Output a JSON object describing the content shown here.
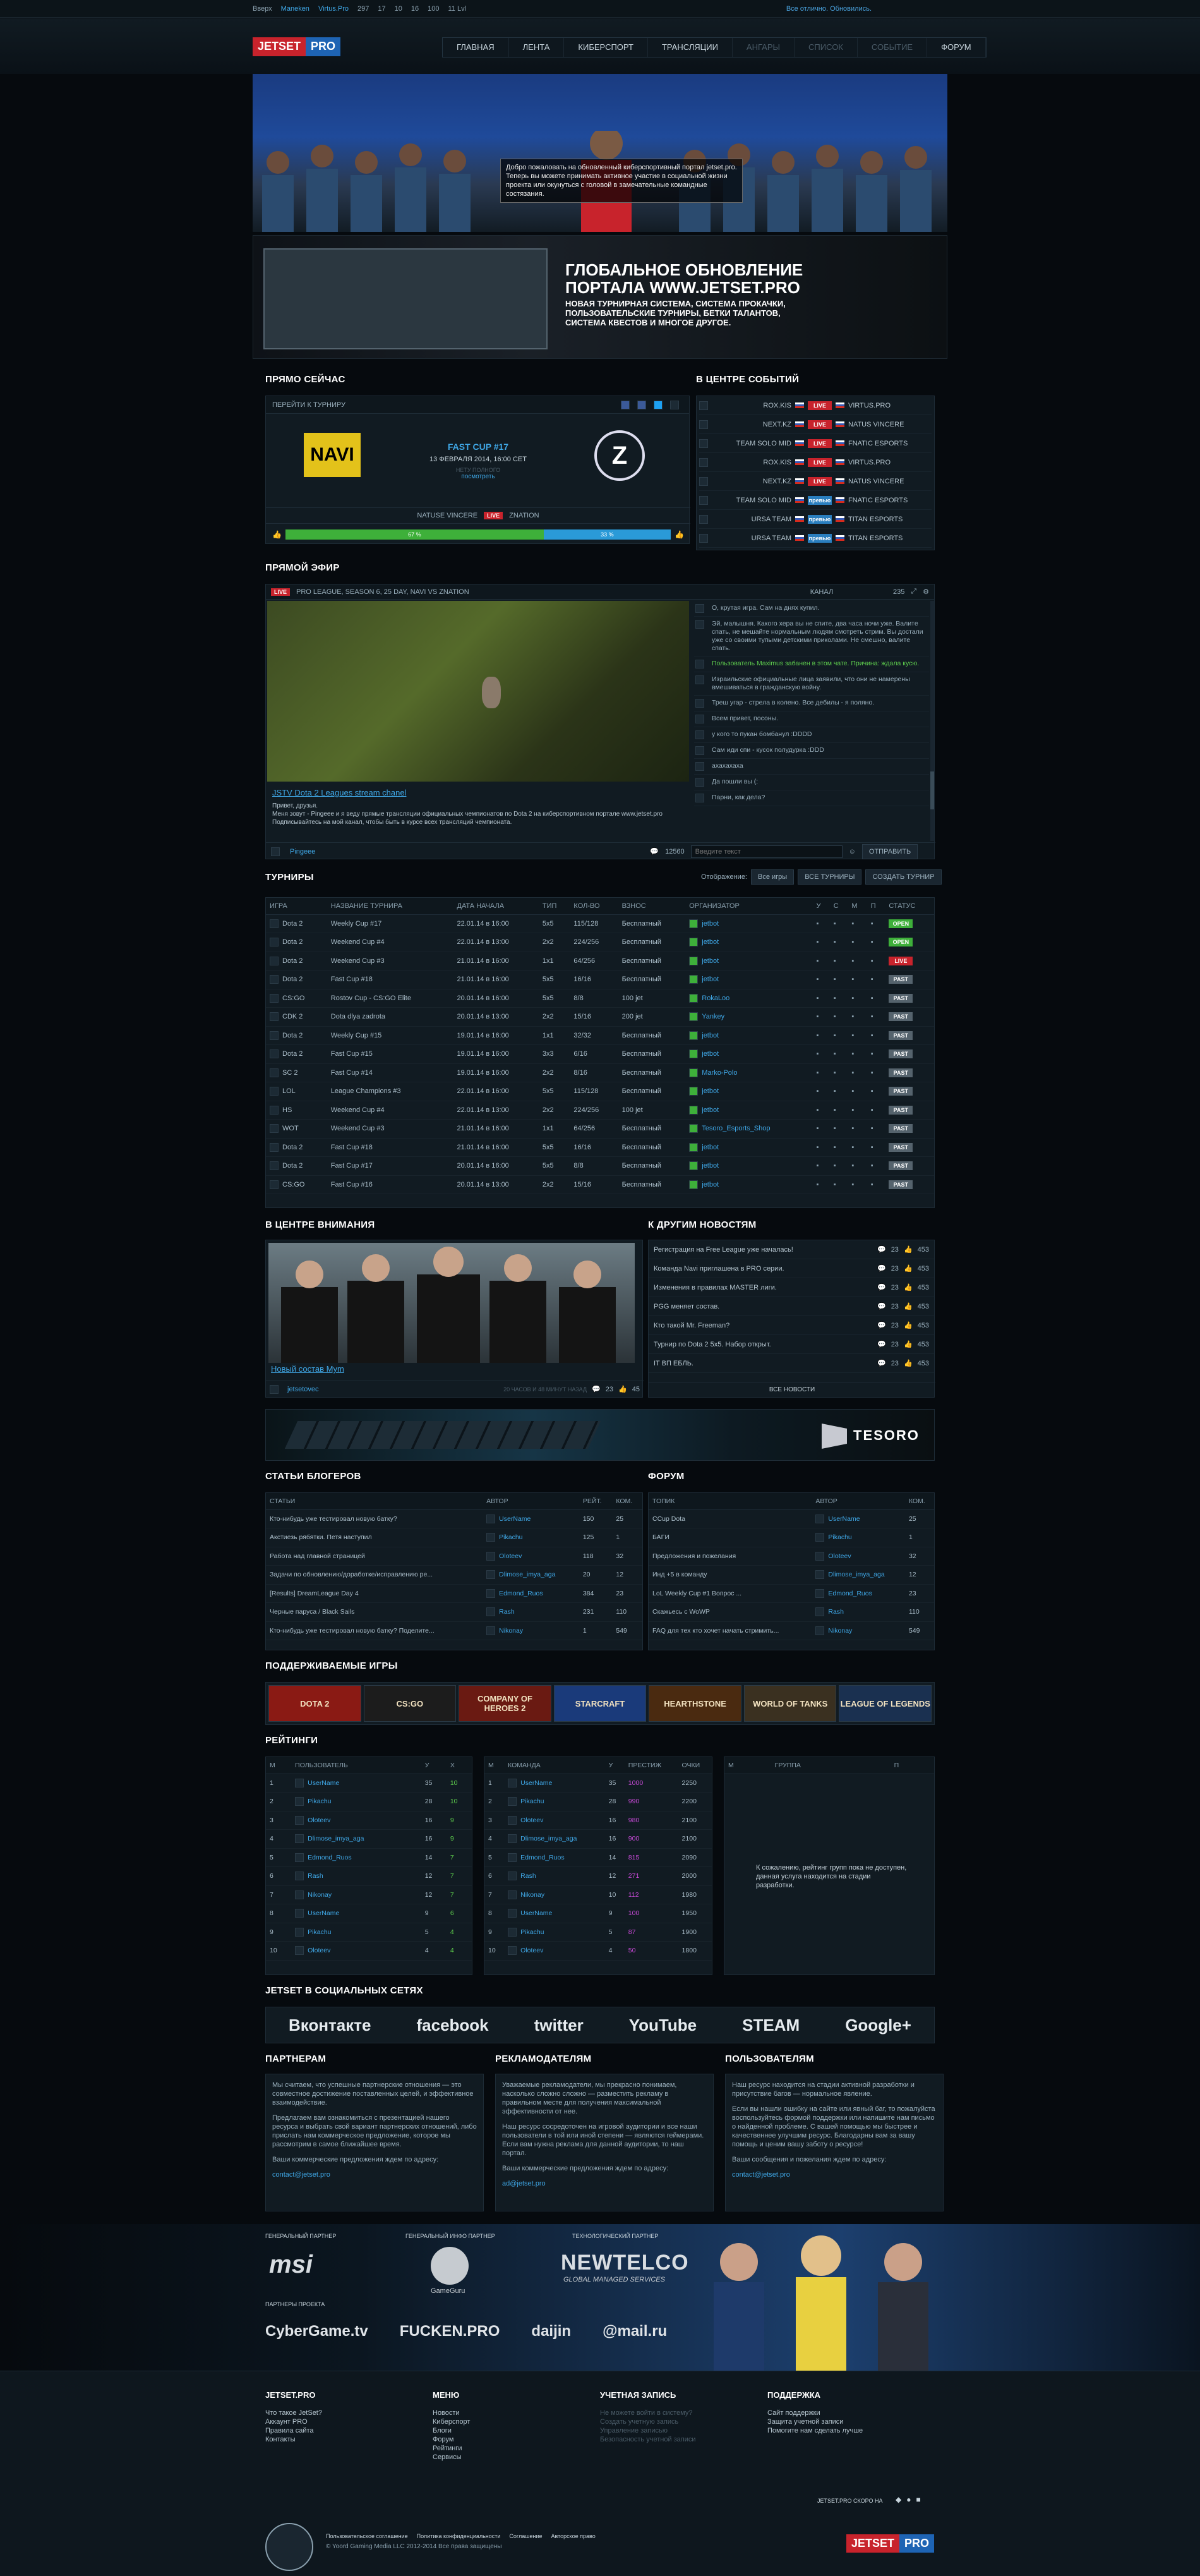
{
  "topbar": {
    "up": "Вверх",
    "items": [
      "Maneken",
      "Virtus.Pro",
      "297",
      "17",
      "10",
      "16",
      "100",
      "11 Lvl"
    ],
    "notice": "Все отлично. Обновились."
  },
  "nav": [
    "ГЛАВНАЯ",
    "ЛЕНТА",
    "КИБЕРСПОРТ",
    "ТРАНСЛЯЦИИ",
    "АНГАРЫ",
    "СПИСОК",
    "СОБЫТИЕ",
    "ФОРУМ"
  ],
  "banner": {
    "speech": "Добро пожаловать на обновленный киберспортивный портал jetset.pro. Теперь вы можете принимать активное участие в социальной жизни проекта или окунуться с головой в замечательные командные состязания."
  },
  "promo": {
    "title": "ГЛОБАЛЬНОЕ ОБНОВЛЕНИЕ ПОРТАЛА WWW.JETSET.PRO",
    "text": "НОВАЯ ТУРНИРНАЯ СИСТЕМА, СИСТЕМА ПРОКАЧКИ, ПОЛЬЗОВАТЕЛЬСКИЕ ТУРНИРЫ, БЕТКИ ТАЛАНТОВ, СИСТЕМА КВЕСТОВ И МНОГОЕ ДРУГОЕ."
  },
  "now": {
    "title": "ПРЯМО СЕЙЧАС",
    "goto": "ПЕРЕЙТИ К ТУРНИРУ",
    "cup": "FAST CUP #17",
    "date": "13 ФЕВРАЛЯ 2014, 16:00 CET",
    "watch": "НЕТУ ПОЛНОГО",
    "watch2": "посмотреть",
    "team1": "NATUSE VINCERE",
    "team2": "ZNATION",
    "left": "67 %",
    "right": "33 %"
  },
  "events": {
    "title": "В ЦЕНТРЕ СОБЫТИЙ",
    "rows": [
      {
        "a": "ROX.KIS",
        "s": "LIVE",
        "b": "VIRTUS.PRO"
      },
      {
        "a": "NEXT.KZ",
        "s": "LIVE",
        "b": "NATUS VINCERE"
      },
      {
        "a": "TEAM SOLO MID",
        "s": "LIVE",
        "b": "FNATIC ESPORTS"
      },
      {
        "a": "ROX.KIS",
        "s": "LIVE",
        "b": "VIRTUS.PRO"
      },
      {
        "a": "NEXT.KZ",
        "s": "LIVE",
        "b": "NATUS VINCERE"
      },
      {
        "a": "TEAM SOLO MID",
        "s": "превью",
        "b": "FNATIC ESPORTS"
      },
      {
        "a": "URSA TEAM",
        "s": "превью",
        "b": "TITAN ESPORTS"
      },
      {
        "a": "URSA TEAM",
        "s": "превью",
        "b": "TITAN ESPORTS"
      }
    ]
  },
  "stream": {
    "title": "ПРЯМОЙ ЭФИР",
    "live": "LIVE",
    "desc": "PRO LEAGUE, SEASON 6, 25 DAY, NAVI VS ZNATION",
    "channel": "КАНАЛ",
    "viewers": "235",
    "name": "JSTV Dota 2 Leagues stream chanel",
    "text": "Привет, друзья.\nМеня зовут - Pingeee и я веду прямые трансляции официальных чемпионатов по Dota 2 на киберспортивном портале www.jetset.pro Подписывайтесь на мой канал, чтобы быть в курсе всех трансляций чемпионата.",
    "author": "Pingeee",
    "count": "12560",
    "placeholder": "Введите текст",
    "send": "ОТПРАВИТЬ",
    "chat": [
      "О, крутая игра. Сам на днях купил.",
      "Эй, малышня. Какого хера вы не спите, два часа ночи уже. Валите спать, не мешайте нормальным людям смотреть стрим. Вы достали уже со своими тупыми детскими приколами. Не смешно, валите спать.",
      "Пользователь Maximus забанен в этом чате. Причина: ждала кусю.",
      "Израильские официальные лица заявили, что они не намерены вмешиваться в гражданскую войну.",
      "Треш угар - стрела в колено. Все дебилы - я поляно.",
      "Всем привет, посоны.",
      "у кого то пукан бомбанул :DDDD",
      "Сам иди спи - кусок полудурка :DDD",
      "ахахахаха",
      "Да пошли вы (:",
      "Парни, как дела?"
    ]
  },
  "tourn": {
    "title": "ТУРНИРЫ",
    "show": "Отображение:",
    "all": "Все игры",
    "alltour": "ВСЕ ТУРНИРЫ",
    "create": "СОЗДАТЬ ТУРНИР",
    "cols": [
      "ИГРА",
      "НАЗВАНИЕ ТУРНИРА",
      "ДАТА НАЧАЛА",
      "ТИП",
      "КОЛ-ВО",
      "ВЗНОС",
      "ОРГАНИЗАТОР",
      "У",
      "С",
      "М",
      "П",
      "СТАТУС"
    ],
    "rows": [
      [
        "Dota 2",
        "Weekly Cup #17",
        "22.01.14 в 16:00",
        "5x5",
        "115/128",
        "Бесплатный",
        "jetbot",
        "OPEN"
      ],
      [
        "Dota 2",
        "Weekend Cup #4",
        "22.01.14 в 13:00",
        "2x2",
        "224/256",
        "Бесплатный",
        "jetbot",
        "OPEN"
      ],
      [
        "Dota 2",
        "Weekend Cup #3",
        "21.01.14 в 16:00",
        "1x1",
        "64/256",
        "Бесплатный",
        "jetbot",
        "LIVE"
      ],
      [
        "Dota 2",
        "Fast Cup #18",
        "21.01.14 в 16:00",
        "5x5",
        "16/16",
        "Бесплатный",
        "jetbot",
        "PAST"
      ],
      [
        "CS:GO",
        "Rostov Cup - CS:GO Elite",
        "20.01.14 в 16:00",
        "5x5",
        "8/8",
        "100 jet",
        "RokaLoo",
        "PAST"
      ],
      [
        "CDK 2",
        "Dota dlya zadrota",
        "20.01.14 в 13:00",
        "2x2",
        "15/16",
        "200 jet",
        "Yankey",
        "PAST"
      ],
      [
        "Dota 2",
        "Weekly Cup #15",
        "19.01.14 в 16:00",
        "1x1",
        "32/32",
        "Бесплатный",
        "jetbot",
        "PAST"
      ],
      [
        "Dota 2",
        "Fast Cup #15",
        "19.01.14 в 16:00",
        "3x3",
        "6/16",
        "Бесплатный",
        "jetbot",
        "PAST"
      ],
      [
        "SC 2",
        "Fast Cup #14",
        "19.01.14 в 16:00",
        "2x2",
        "8/16",
        "Бесплатный",
        "Marko-Polo",
        "PAST"
      ],
      [
        "LOL",
        "League Champions #3",
        "22.01.14 в 16:00",
        "5x5",
        "115/128",
        "Бесплатный",
        "jetbot",
        "PAST"
      ],
      [
        "HS",
        "Weekend Cup #4",
        "22.01.14 в 13:00",
        "2x2",
        "224/256",
        "100 jet",
        "jetbot",
        "PAST"
      ],
      [
        "WOT",
        "Weekend Cup #3",
        "21.01.14 в 16:00",
        "1x1",
        "64/256",
        "Бесплатный",
        "Tesoro_Esports_Shop",
        "PAST"
      ],
      [
        "Dota 2",
        "Fast Cup #18",
        "21.01.14 в 16:00",
        "5x5",
        "16/16",
        "Бесплатный",
        "jetbot",
        "PAST"
      ],
      [
        "Dota 2",
        "Fast Cup #17",
        "20.01.14 в 16:00",
        "5x5",
        "8/8",
        "Бесплатный",
        "jetbot",
        "PAST"
      ],
      [
        "CS:GO",
        "Fast Cup #16",
        "20.01.14 в 13:00",
        "2x2",
        "15/16",
        "Бесплатный",
        "jetbot",
        "PAST"
      ]
    ]
  },
  "focus": {
    "title": "В ЦЕНТРЕ ВНИМАНИЯ",
    "caption": "Новый состав Mym",
    "author": "jetsetovec",
    "time": "20 ЧАСОВ И 48 МИНУТ НАЗАД",
    "c": "23",
    "l": "45"
  },
  "news": {
    "title": "К ДРУГИМ НОВОСТЯМ",
    "all": "ВСЕ НОВОСТИ",
    "items": [
      "Регистрация на Free League уже началась!",
      "Команда Navi приглашена в PRO серии.",
      "Изменения в правилах MASTER лиги.",
      "PGG меняет состав.",
      "Кто такой Mr. Freeman?",
      "Турнир по Dota 2 5x5. Набор открыт.",
      "IT ВП ЕБЛЬ."
    ],
    "c": "23",
    "l": "453"
  },
  "ad": {
    "brand": "TESORO"
  },
  "blogs": {
    "title": "СТАТЬИ БЛОГЕРОВ",
    "cols": [
      "СТАТЬИ",
      "АВТОР",
      "РЕЙТ.",
      "КОМ."
    ],
    "rows": [
      [
        "Кто-нибудь уже тестировал новую батку?",
        "UserName",
        "150",
        "25"
      ],
      [
        "Акстиезь рябятки. Петя наступил",
        "Pikachu",
        "125",
        "1"
      ],
      [
        "Работа над главной страницей",
        "Oloteev",
        "118",
        "32"
      ],
      [
        "Задачи по обновлению/доработке/исправлению ре...",
        "Dlimose_imya_aga",
        "20",
        "12"
      ],
      [
        "[Results] DreamLeague Day 4",
        "Edmond_Ruos",
        "384",
        "23"
      ],
      [
        "Черные паруса / Black Sails",
        "Rash",
        "231",
        "110"
      ],
      [
        "Кто-нибудь уже тестировал новую батку? Поделите...",
        "Nikonay",
        "1",
        "549"
      ]
    ]
  },
  "forum": {
    "title": "ФОРУМ",
    "cols": [
      "ТОПИК",
      "АВТОР",
      "КОМ."
    ],
    "rows": [
      [
        "CCup Dota",
        "UserName",
        "25"
      ],
      [
        "БАГИ",
        "Pikachu",
        "1"
      ],
      [
        "Предложения и пожелания",
        "Oloteev",
        "32"
      ],
      [
        "Инд +5 в команду",
        "Dlimose_imya_aga",
        "12"
      ],
      [
        "LoL Weekly Cup #1 Вопрос ...",
        "Edmond_Ruos",
        "23"
      ],
      [
        "Скажьесь с WoWP",
        "Rash",
        "110"
      ],
      [
        "FAQ для тех кто хочет начать стримить...",
        "Nikonay",
        "549"
      ]
    ]
  },
  "games": {
    "title": "ПОДДЕРЖИВАЕМЫЕ ИГРЫ",
    "items": [
      "DOTA 2",
      "CS:GO",
      "COMPANY OF HEROES 2",
      "STARCRAFT",
      "HEARTHSTONE",
      "WORLD OF TANKS",
      "LEAGUE OF LEGENDS"
    ]
  },
  "ratings": {
    "title": "РЕЙТИНГИ",
    "users": {
      "cols": [
        "М",
        "ПОЛЬЗОВАТЕЛЬ",
        "У",
        "Х"
      ],
      "rows": [
        [
          "1",
          "UserName",
          "35",
          "10"
        ],
        [
          "2",
          "Pikachu",
          "28",
          "10"
        ],
        [
          "3",
          "Oloteev",
          "16",
          "9"
        ],
        [
          "4",
          "Dlimose_imya_aga",
          "16",
          "9"
        ],
        [
          "5",
          "Edmond_Ruos",
          "14",
          "7"
        ],
        [
          "6",
          "Rash",
          "12",
          "7"
        ],
        [
          "7",
          "Nikonay",
          "12",
          "7"
        ],
        [
          "8",
          "UserName",
          "9",
          "6"
        ],
        [
          "9",
          "Pikachu",
          "5",
          "4"
        ],
        [
          "10",
          "Oloteev",
          "4",
          "4"
        ]
      ]
    },
    "teams": {
      "cols": [
        "М",
        "КОМАНДА",
        "У",
        "ПРЕСТИЖ",
        "ОЧКИ"
      ],
      "rows": [
        [
          "1",
          "UserName",
          "35",
          "1000",
          "2250"
        ],
        [
          "2",
          "Pikachu",
          "28",
          "990",
          "2200"
        ],
        [
          "3",
          "Oloteev",
          "16",
          "980",
          "2100"
        ],
        [
          "4",
          "Dlimose_imya_aga",
          "16",
          "900",
          "2100"
        ],
        [
          "5",
          "Edmond_Ruos",
          "14",
          "815",
          "2090"
        ],
        [
          "6",
          "Rash",
          "12",
          "271",
          "2000"
        ],
        [
          "7",
          "Nikonay",
          "10",
          "112",
          "1980"
        ],
        [
          "8",
          "UserName",
          "9",
          "100",
          "1950"
        ],
        [
          "9",
          "Pikachu",
          "5",
          "87",
          "1900"
        ],
        [
          "10",
          "Oloteev",
          "4",
          "50",
          "1800"
        ]
      ]
    },
    "groups": {
      "cols": [
        "М",
        "ГРУППА",
        "П"
      ],
      "empty": "К сожалению, рейтинг групп пока не доступен, данная услуга находится на стадии разработки."
    }
  },
  "social": {
    "title": "JETSET В СОЦИАЛЬНЫХ СЕТЯХ",
    "items": [
      "Вконтакте",
      "facebook",
      "twitter",
      "YouTube",
      "STEAM",
      "Google+"
    ]
  },
  "info": [
    {
      "title": "ПАРТНЕРАМ",
      "p1": "Мы считаем, что успешные партнерские отношения — это совместное достижение поставленных целей, и эффективное взаимодействие.",
      "p2": "Предлагаем вам ознакомиться с презентацией нашего ресурса и выбрать свой вариант партнерских отношений, либо прислать нам коммерческое предложение, которое мы рассмотрим в самое ближайшее время.",
      "p3": "Ваши коммерческие предложения ждем по адресу:",
      "mail": "contact@jetset.pro"
    },
    {
      "title": "РЕКЛАМОДАТЕЛЯМ",
      "p1": "Уважаемые рекламодатели, мы прекрасно понимаем, насколько сложно сложно — разместить рекламу в правильном месте для получения максимальной эффективности от нее.",
      "p2": "Наш ресурс сосредоточен на игровой аудитории и все наши пользователи в той или иной степени — являются геймерами. Если вам нужна реклама для данной аудитории, то наш портал.",
      "p3": "Ваши коммерческие предложения ждем по адресу:",
      "mail": "ad@jetset.pro"
    },
    {
      "title": "ПОЛЬЗОВАТЕЛЯМ",
      "p1": "Наш ресурс находится на стадии активной разработки и присутствие багов — нормальное явление.",
      "p2": "Если вы нашли ошибку на сайте или явный баг, то пожалуйста воспользуйтесь формой поддержки или напишите нам письмо о найденной проблеме. С вашей помощью мы быстрее и качественнее улучшим ресурс. Благодарны вам за вашу помощь и ценим вашу заботу о ресурсе!",
      "p3": "Ваши сообщения и пожелания ждем по адресу:",
      "mail": "contact@jetset.pro"
    }
  ],
  "partners": {
    "general": "ГЕНЕРАЛЬНЫЙ ПАРТНЕР",
    "info": "ГЕНЕРАЛЬНЫЙ ИНФО ПАРТНЕР",
    "tech": "ТЕХНОЛОГИЧЕСКИЙ ПАРТНЕР",
    "project": "ПАРТНЕРЫ ПРОЕКТА",
    "msi": "msi",
    "gg": "GameGuru",
    "nt": "NEWTELCO",
    "nt2": "GLOBAL MANAGED SERVICES",
    "p": [
      "CyberGame.tv",
      "FUCKEN.PRO",
      "daijin",
      "@mail.ru"
    ]
  },
  "footer": {
    "cols": [
      {
        "title": "JETSET.PRO",
        "items": [
          "Что такое JetSet?",
          "Аккаунт PRO",
          "Правила сайта",
          "Контакты"
        ]
      },
      {
        "title": "МЕНЮ",
        "items": [
          "Новости",
          "Киберспорт",
          "Блоги",
          "Форум",
          "Рейтинги",
          "Сервисы"
        ]
      },
      {
        "title": "УЧЕТНАЯ ЗАПИСЬ",
        "items": [
          "Не можете войти в систему?",
          "Создать учетную запись",
          "Управление записью",
          "Безопасность учетной записи"
        ]
      },
      {
        "title": "ПОДДЕРЖКА",
        "items": [
          "Сайт поддержки",
          "Защита учетной записи",
          "Помогите нам сделать лучше"
        ]
      }
    ],
    "soon": "JETSET.PRO СКОРО НА",
    "links": [
      "Пользовательское соглашение",
      "Политика конфиденциальности",
      "Соглашение",
      "Авторское право"
    ],
    "copy": "© Yoord Gaming Media LLC 2012-2014 Все права защищены",
    "logoA": "JETSET",
    "logoB": "PRO"
  }
}
